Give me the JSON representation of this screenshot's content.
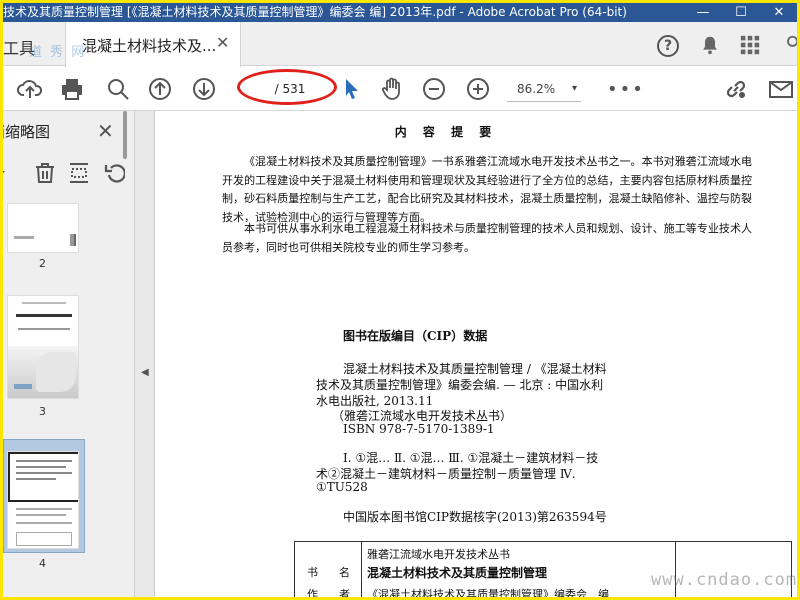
{
  "titlebar": {
    "title": "技术及其质量控制管理 [《混凝土材料技术及其质量控制管理》编委会 编] 2013年.pdf - Adobe Acrobat Pro (64-bit)",
    "minimize": "—",
    "maximize": "☐",
    "close": "✕"
  },
  "tabs": {
    "tools_label": "工具",
    "doc_label": "混凝土材料技术及...",
    "close_glyph": "✕",
    "watermark": "道 秀 网"
  },
  "toolbar": {
    "page_current": "",
    "page_total": "/ 531",
    "zoom": "86.2%",
    "zoom_arrow": "▾",
    "more": "•••"
  },
  "leftpanel": {
    "title": "页面缩略图",
    "close": "✕",
    "thumbs": [
      {
        "num": "2"
      },
      {
        "num": "3"
      },
      {
        "num": "4"
      }
    ]
  },
  "doc": {
    "content_heading": "内 容 提 要",
    "para1": "《混凝土材料技术及其质量控制管理》一书系雅砻江流域水电开发技术丛书之一。本书对雅砻江流域水电开发的工程建设中关于混凝土材料使用和管理现状及其经验进行了全方位的总结，主要内容包括原材料质量控制，砂石料质量控制与生产工艺，配合比研究及其材料技术，混凝土质量控制，混凝土缺陷修补、温控与防裂技术，试验检测中心的运行与管理等方面。",
    "para2": "本书可供从事水利水电工程混凝土材料技术与质量控制管理的技术人员和规划、设计、施工等专业技术人员参考，同时也可供相关院校专业的师生学习参考。",
    "cip_title": "图书在版编目（CIP）数据",
    "cip_lines": [
      "混凝土材料技术及其质量控制管理 / 《混凝土材料",
      "技术及其质量控制管理》编委会编. — 北京 : 中国水利",
      "水电出版社, 2013.11",
      "（雅砻江流域水电开发技术丛书）",
      "ISBN 978-7-5170-1389-1",
      "Ⅰ. ①混… Ⅱ. ①混… Ⅲ. ①混凝土－建筑材料－技",
      "术②混凝土－建筑材料－质量控制－质量管理 Ⅳ.",
      "①TU528",
      "中国版本图书馆CIP数据核字(2013)第263594号"
    ],
    "bookinfo": {
      "label_shu": "书",
      "label_ming": "名",
      "label_zuo": "作",
      "label_zhe": "者",
      "series": "雅砻江流域水电开发技术丛书",
      "book_title": "混凝土材料技术及其质量控制管理",
      "author": "《混凝土材料技术及其质量控制管理》编委会　编"
    }
  },
  "watermark_br": "www.cndao.com"
}
